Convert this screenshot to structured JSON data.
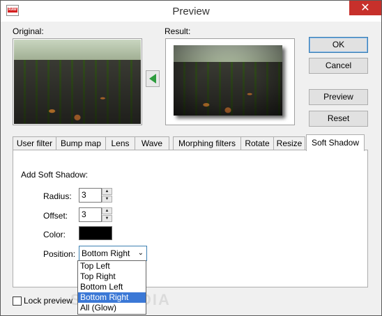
{
  "window": {
    "title": "Preview",
    "icon": "raw-app-icon",
    "icon_text": "RAW",
    "close_glyph": "✕"
  },
  "preview": {
    "original_label": "Original:",
    "result_label": "Result:",
    "transfer_icon": "green-left-arrow-icon"
  },
  "buttons": {
    "ok": "OK",
    "cancel": "Cancel",
    "preview": "Preview",
    "reset": "Reset"
  },
  "tabs": [
    {
      "label": "User filter",
      "active": false
    },
    {
      "label": "Bump map",
      "active": false
    },
    {
      "label": "Lens",
      "active": false
    },
    {
      "label": "Wave",
      "active": false
    },
    {
      "label": "Morphing filters",
      "active": false
    },
    {
      "label": "Rotate",
      "active": false
    },
    {
      "label": "Resize",
      "active": false
    },
    {
      "label": "Soft Shadow",
      "active": true
    }
  ],
  "soft_shadow": {
    "heading": "Add Soft Shadow:",
    "radius_label": "Radius:",
    "radius_value": "3",
    "offset_label": "Offset:",
    "offset_value": "3",
    "color_label": "Color:",
    "color_value": "#000000",
    "position_label": "Position:",
    "position_value": "Bottom Right",
    "position_options": [
      "Top Left",
      "Top Right",
      "Bottom Left",
      "Bottom Right",
      "All (Glow)"
    ],
    "position_selected_index": 3
  },
  "lock_preview": {
    "label": "Lock preview",
    "checked": false
  },
  "watermark": "SOFTPEDIA"
}
